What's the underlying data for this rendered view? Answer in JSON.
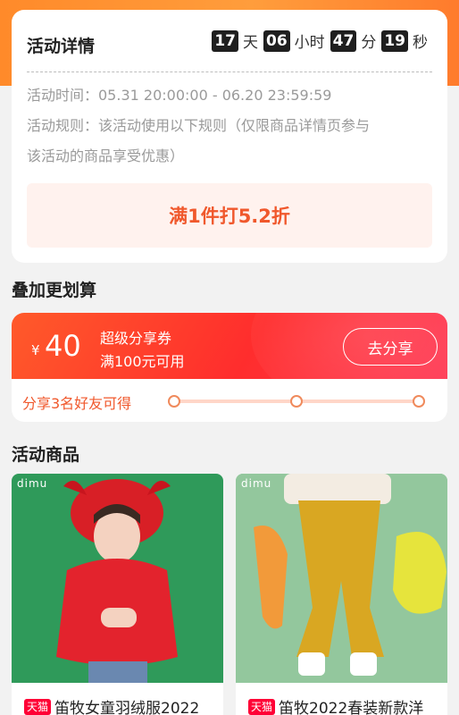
{
  "activity": {
    "title": "活动详情",
    "countdown": [
      {
        "value": "17",
        "unit": "天"
      },
      {
        "value": "06",
        "unit": "小时"
      },
      {
        "value": "47",
        "unit": "分"
      },
      {
        "value": "19",
        "unit": "秒"
      }
    ],
    "time_line": "活动时间：05.31 20:00:00 - 06.20 23:59:59",
    "rule_line1": "活动规则：该活动使用以下规则（仅限商品详情页参与",
    "rule_line2": "该活动的商品享受优惠）",
    "discount": "满1件打5.2折"
  },
  "stack_section": {
    "title": "叠加更划算",
    "coupon": {
      "currency": "¥",
      "amount": "40",
      "name": "超级分享券",
      "condition": "满100元可用",
      "button": "去分享"
    },
    "progress_text": "分享3名好友可得",
    "progress_steps": 3
  },
  "products_section": {
    "title": "活动商品",
    "items": [
      {
        "brand": "dimu",
        "badge": "天猫",
        "title": "笛牧女童羽绒服2022"
      },
      {
        "brand": "dimu",
        "badge": "天猫",
        "title": "笛牧2022春装新款洋"
      }
    ]
  },
  "colors": {
    "accent": "#f0582c",
    "coupon_red": "#ff2d2d",
    "header_orange": "#ff8a2a"
  }
}
